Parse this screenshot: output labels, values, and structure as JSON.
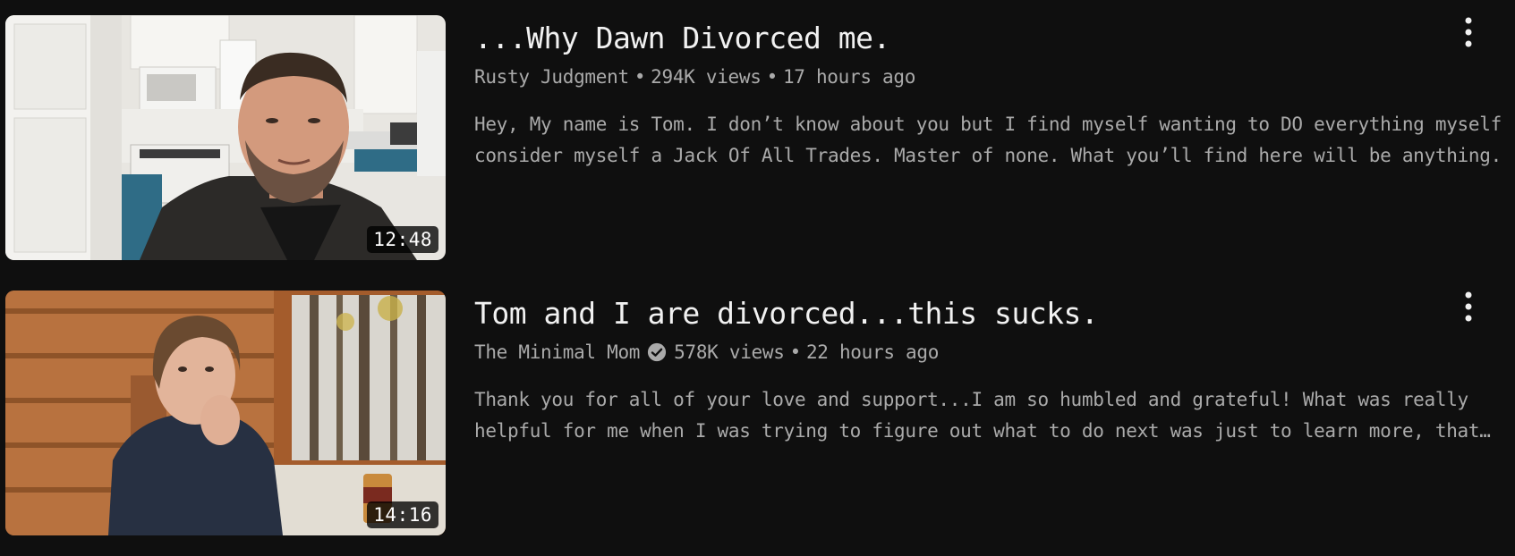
{
  "videos": [
    {
      "title": "...Why Dawn Divorced me.",
      "channel": "Rusty Judgment",
      "verified": false,
      "views": "294K views",
      "age": "17 hours ago",
      "duration": "12:48",
      "description_lines": [
        "Hey, My name is Tom. I don’t know about you but I find myself wanting to DO everything myself. I",
        "consider myself a Jack Of All Trades. Master of none. What you’ll find here will be anything..."
      ]
    },
    {
      "title": "Tom and I are divorced...this sucks.",
      "channel": "The Minimal Mom",
      "verified": true,
      "views": "578K views",
      "age": "22 hours ago",
      "duration": "14:16",
      "description_lines": [
        "Thank you for all of your love and support...I am so humbled and grateful! What was really",
        "helpful for me when I was trying to figure out what to do next was just to learn more, that…"
      ]
    }
  ],
  "separator": "•",
  "icons": {
    "menu": "more-vert-icon",
    "verified": "verified-check-icon"
  },
  "colors": {
    "background": "#0f0f0f",
    "title": "#f1f1f1",
    "secondary": "#aaaaaa"
  }
}
